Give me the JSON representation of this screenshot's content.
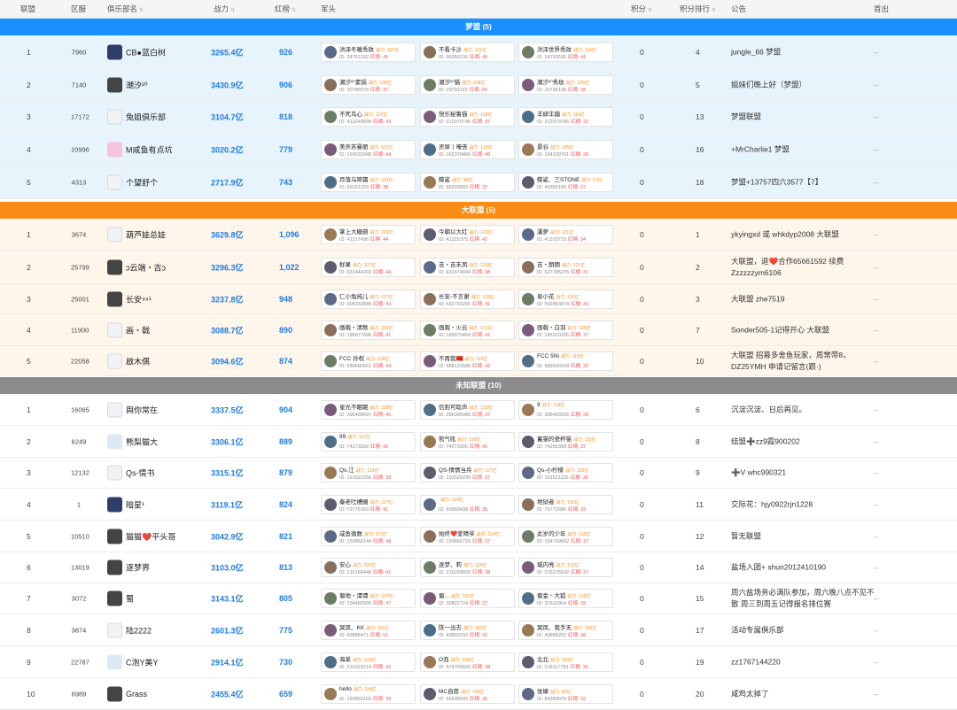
{
  "columns": {
    "rank": "联盟",
    "zone": "区服",
    "club": "俱乐部名",
    "power": "战力",
    "red": "红榜",
    "leader": "军头",
    "score": "积分",
    "score_rank": "积分排行",
    "notice": "公告",
    "first": "首出"
  },
  "sections": [
    {
      "title": "梦盟 (5)",
      "theme": "blue",
      "color": "#1890ff",
      "rows": [
        {
          "rank": "1",
          "zone": "7960",
          "club": "CB●蓝白树",
          "power": "3265.4亿",
          "red": "926",
          "leaders": [
            {
              "name": "洪泽冬暖秀玫",
              "power": "战力: 123亿",
              "id": "ID: 24761232",
              "red": "红榜: 45"
            },
            {
              "name": "不看卡沙",
              "power": "战力: 121亿",
              "id": "ID: 95359136",
              "red": "红榜: 45"
            },
            {
              "name": "洪泽世界秀玫",
              "power": "战力: 119亿",
              "id": "ID: 24763535",
              "red": "红榜: 41"
            }
          ],
          "score": "0",
          "score_rank": "4",
          "notice": "jungle_66 梦盟",
          "first": "--"
        },
        {
          "rank": "2",
          "zone": "7140",
          "club": "潮汐²⁰",
          "power": "3430.9亿",
          "red": "906",
          "leaders": [
            {
              "name": "潮汐²⁰素锅",
              "power": "战力: 130亿",
              "id": "ID: 20786079",
              "red": "红榜: 37"
            },
            {
              "name": "潮汐²⁰猫",
              "power": "战力: 128亿",
              "id": "ID: 20791122",
              "red": "红榜: 34"
            },
            {
              "name": "潮汐²⁰秀玫",
              "power": "战力: 126亿",
              "id": "ID: 20795108",
              "red": "红榜: 28"
            }
          ],
          "score": "0",
          "score_rank": "5",
          "notice": "姐妹们晚上好（梦盟）",
          "first": "--"
        },
        {
          "rank": "3",
          "zone": "17172",
          "club": "兔姐俱乐部",
          "power": "3104.7亿",
          "red": "818",
          "leaders": [
            {
              "name": "不死鸟心",
              "power": "战力: 122亿",
              "id": "ID: 413249599",
              "red": "红榜: 43"
            },
            {
              "name": "快乐秘鲁猫",
              "power": "战力: 118亿",
              "id": "ID: 312079746",
              "red": "红榜: 37"
            },
            {
              "name": "丰肆丰蹦",
              "power": "战力: 113亿",
              "id": "ID: 312079786",
              "red": "红榜: 32"
            }
          ],
          "score": "0",
          "score_rank": "13",
          "notice": "梦盟联盟",
          "first": "--"
        },
        {
          "rank": "4",
          "zone": "10996",
          "club": "M咸鱼有点坑",
          "power": "3020.2亿",
          "red": "779",
          "leaders": [
            {
              "name": "美声苏曼丽",
              "power": "战力: 121亿",
              "id": "ID: 155633348",
              "red": "红榜: 44"
            },
            {
              "name": "灵犀丨嚎丧",
              "power": "战力: 119亿",
              "id": "ID: 162378466",
              "red": "红榜: 43"
            },
            {
              "name": "景谷",
              "power": "战力: 105亿",
              "id": "ID: 154109761",
              "red": "红榜: 26"
            }
          ],
          "score": "0",
          "score_rank": "16",
          "notice": "+MrCharlie1 梦盟",
          "first": "--"
        },
        {
          "rank": "5",
          "zone": "4313",
          "club": "个望舒个",
          "power": "2717.9亿",
          "red": "743",
          "leaders": [
            {
              "name": "月落乌啼霜",
              "power": "战力: 101亿",
              "id": "ID: 50161229",
              "red": "红榜: 38"
            },
            {
              "name": "鲸鲨",
              "power": "战力: 98亿",
              "id": "ID: 66203802",
              "red": "红榜: 32"
            },
            {
              "name": "鲸鲨、三STONE",
              "power": "战力: 97亿",
              "id": "ID: 49355189",
              "red": "红榜: 27"
            }
          ],
          "score": "0",
          "score_rank": "18",
          "notice": "梦盟+13757四六3577【7】",
          "first": "--"
        }
      ]
    },
    {
      "title": "大联盟 (5)",
      "theme": "orange",
      "color": "#fa8c16",
      "rows": [
        {
          "rank": "1",
          "zone": "3674",
          "club": "葫芦娃总娃",
          "power": "3629.8亿",
          "red": "1,096",
          "leaders": [
            {
              "name": "掌上大糖葫",
              "power": "战力: 129亿",
              "id": "ID: 41317436",
              "red": "红榜: 44"
            },
            {
              "name": "今朝以大红",
              "power": "战力: 123亿",
              "id": "ID: 41315375",
              "red": "红榜: 42"
            },
            {
              "name": "瀑萝",
              "power": "战力: 121亿",
              "id": "ID: 41315710",
              "red": "红榜: 34"
            }
          ],
          "score": "0",
          "score_rank": "1",
          "notice": "ykyingxd 或 whkdyp2008 大联盟",
          "first": "--"
        },
        {
          "rank": "2",
          "zone": "25799",
          "club": "ↄ云端・吉ↄ",
          "power": "3296.3亿",
          "red": "1,022",
          "leaders": [
            {
              "name": "鲜果",
              "power": "战力: 127亿",
              "id": "ID: 631444202",
              "red": "红榜: 44"
            },
            {
              "name": "吉・吉末凤",
              "power": "战力: 125亿",
              "id": "ID: 631474844",
              "red": "红榜: 38"
            },
            {
              "name": "吉・朗朗",
              "power": "战力: 121亿",
              "id": "ID: 627785376",
              "red": "红榜: 31"
            }
          ],
          "score": "0",
          "score_rank": "2",
          "notice": "大联盟，退❤️合作65661592 续费Zzzzzzym6106",
          "first": "--"
        },
        {
          "rank": "3",
          "zone": "25001",
          "club": "长安⁹⁹¹",
          "power": "3237.8亿",
          "red": "948",
          "leaders": [
            {
              "name": "仁小兔纯儿",
              "power": "战力: 127亿",
              "id": "ID: 608333589",
              "red": "红榜: 43"
            },
            {
              "name": "长安-不言谢",
              "power": "战力: 123亿",
              "id": "ID: 592733265",
              "red": "红榜: 41"
            },
            {
              "name": "易小花",
              "power": "战力: 115亿",
              "id": "ID: 592863874",
              "red": "红榜: 36"
            }
          ],
          "score": "0",
          "score_rank": "3",
          "notice": "大联盟 zhe7519",
          "first": "--"
        },
        {
          "rank": "4",
          "zone": "11900",
          "club": "画・戟",
          "power": "3088.7亿",
          "red": "890",
          "leaders": [
            {
              "name": "画戟・清歌",
              "power": "战力: 122亿",
              "id": "ID: 185877496",
              "red": "红榜: 41"
            },
            {
              "name": "画戟・火云",
              "power": "战力: 121亿",
              "id": "ID: 185870464",
              "red": "红榜: 41"
            },
            {
              "name": "画戟・白羽",
              "power": "战力: 120亿",
              "id": "ID: 185310326",
              "red": "红榜: 37"
            }
          ],
          "score": "0",
          "score_rank": "7",
          "notice": "Sonder505-1记得开心 大联盟",
          "first": "--"
        },
        {
          "rank": "5",
          "zone": "22058",
          "club": "啟︎木偶",
          "power": "3094.6亿",
          "red": "874",
          "leaders": [
            {
              "name": "FCC 孙权",
              "power": "战力: 128亿",
              "id": "ID: 589690561",
              "red": "红榜: 44"
            },
            {
              "name": "不再我🇨🇳",
              "power": "战力: 115亿",
              "id": "ID: 588133589",
              "red": "红榜: 42"
            },
            {
              "name": "FCC 5Ni",
              "power": "战力: 119亿",
              "id": "ID: 589600109",
              "red": "红榜: 32"
            }
          ],
          "score": "0",
          "score_rank": "10",
          "notice": "大联盟 招募多舍鱼玩家，周常带8，DZ25YMH 申请记留言(跟·)",
          "first": "--"
        }
      ]
    },
    {
      "title": "未知联盟 (10)",
      "theme": "white",
      "color": "#8c8c8c",
      "rows": [
        {
          "rank": "1",
          "zone": "16065",
          "club": "舆你常在",
          "power": "3337.5亿",
          "red": "904",
          "leaders": [
            {
              "name": "星光不眠眠",
              "power": "战力: 128亿",
              "id": "ID: 396499697",
              "red": "红榜: 46"
            },
            {
              "name": "信则可取声",
              "power": "战力: 120亿",
              "id": "ID: 396395086",
              "red": "红榜: 37"
            },
            {
              "name": "9",
              "power": "战力: 119亿",
              "id": "ID: 398499335",
              "red": "红榜: 28"
            }
          ],
          "score": "0",
          "score_rank": "6",
          "notice": "沉淀沉淀、日后再见。",
          "first": "--"
        },
        {
          "rank": "2",
          "zone": "6249",
          "club": "熊梨猫大",
          "power": "3306.1亿",
          "red": "889",
          "leaders": [
            {
              "name": "99",
              "power": "战力: 127亿",
              "id": "ID: 74273299",
              "red": "红榜: 43"
            },
            {
              "name": "熊气吼",
              "power": "战力: 126亿",
              "id": "ID: 74273306",
              "red": "红榜: 41"
            },
            {
              "name": "蓄猫的瓷杯猫",
              "power": "战力: 115亿",
              "id": "ID: 74265399",
              "red": "红榜: 37"
            }
          ],
          "score": "0",
          "score_rank": "8",
          "notice": "结盟➕zz9霞900202",
          "first": "--"
        },
        {
          "rank": "3",
          "zone": "12132",
          "club": "Qs-情书",
          "power": "3315.1亿",
          "red": "879",
          "leaders": [
            {
              "name": "Qs.江",
              "power": "战力: 131亿",
              "id": "ID: 191522256",
              "red": "红榜: 38"
            },
            {
              "name": "QS-情情当兵",
              "power": "战力: 127亿",
              "id": "ID: 191520200",
              "red": "红榜: 37"
            },
            {
              "name": "Qs-小柠檬",
              "power": "战力: 126亿",
              "id": "ID: 191521125",
              "red": "红榜: 35"
            }
          ],
          "score": "0",
          "score_rank": "9",
          "notice": "➕V whc990321",
          "first": "--"
        },
        {
          "rank": "4",
          "zone": "1",
          "club": "暗星¹",
          "power": "3119.1亿",
          "red": "824",
          "leaders": [
            {
              "name": "秦老吐槽圈",
              "power": "战力: 127亿",
              "id": "ID: 73776393",
              "red": "红榜: 41"
            },
            {
              "name": "",
              "power": "战力: 119亿",
              "id": "ID: 60983438",
              "red": "红榜: 35"
            },
            {
              "name": "地狱者",
              "power": "战力: 115亿",
              "id": "ID: 76772686",
              "red": "红榜: 32"
            }
          ],
          "score": "0",
          "score_rank": "11",
          "notice": "交际花：hjy0922rjn1228",
          "first": "--"
        },
        {
          "rank": "5",
          "zone": "10510",
          "club": "猫猫❤️平头哥",
          "power": "3042.9亿",
          "red": "821",
          "leaders": [
            {
              "name": "咸鱼微数",
              "power": "战力: 117亿",
              "id": "ID: 150866144",
              "red": "红榜: 48"
            },
            {
              "name": "始终❤️爱晴爷",
              "power": "战力: 114亿",
              "id": "ID: 150866715",
              "red": "红榜: 37"
            },
            {
              "name": "此岁的少年",
              "power": "战力: 110亿",
              "id": "ID: 154709662",
              "red": "红榜: 37"
            }
          ],
          "score": "0",
          "score_rank": "12",
          "notice": "暂无联盟",
          "first": "--"
        },
        {
          "rank": "6",
          "zone": "13019",
          "club": "逐梦界",
          "power": "3103.0亿",
          "red": "813",
          "leaders": [
            {
              "name": "安心",
              "power": "战力: 126亿",
              "id": "ID: 215180448",
              "red": "红榜: 41"
            },
            {
              "name": "逐梦、莉",
              "power": "战力: 124亿",
              "id": "ID: 215269826",
              "red": "红榜: 38"
            },
            {
              "name": "城内亮",
              "power": "战力: 113亿",
              "id": "ID: 215275542",
              "red": "红榜: 37"
            }
          ],
          "score": "0",
          "score_rank": "14",
          "notice": "盐场入团+ shun2012410190",
          "first": "--"
        },
        {
          "rank": "7",
          "zone": "3072",
          "club": "蜀",
          "power": "3143.1亿",
          "red": "805",
          "leaders": [
            {
              "name": "蜀地・谭谭",
              "power": "战力: 127亿",
              "id": "ID: 234460309",
              "red": "红榜: 47"
            },
            {
              "name": "蜀...",
              "power": "战力: 121亿",
              "id": "ID: 30822724",
              "red": "红榜: 37"
            },
            {
              "name": "蜀金丶大狐",
              "power": "战力: 116亿",
              "id": "ID: 37610364",
              "red": "红榜: 33"
            }
          ],
          "score": "0",
          "score_rank": "15",
          "notice": "周六盐场务必满队参加，周六晚八点不见不散 周三到周五记得报名排位赛",
          "first": "--"
        },
        {
          "rank": "8",
          "zone": "3874",
          "club": "陆2222",
          "power": "2601.3亿",
          "red": "775",
          "leaders": [
            {
              "name": "冥凤、KK",
              "power": "战力: 111亿",
              "id": "ID: 43886471",
              "red": "红榜: 51"
            },
            {
              "name": "陈一出去",
              "power": "战力: 109亿",
              "id": "ID: 43893232",
              "red": "红榜: 42"
            },
            {
              "name": "冥凤、我手无",
              "power": "战力: 105亿",
              "id": "ID: 43885252",
              "red": "红榜: 38"
            }
          ],
          "score": "0",
          "score_rank": "17",
          "notice": "活动专属俱乐部",
          "first": "--"
        },
        {
          "rank": "9",
          "zone": "22787",
          "club": "C泡Y美Y",
          "power": "2914.1亿",
          "red": "730",
          "leaders": [
            {
              "name": "海某",
              "power": "战力: 128亿",
              "id": "ID: 515323214",
              "red": "红榜: 42"
            },
            {
              "name": "O泡",
              "power": "战力: 109亿",
              "id": "ID: 574765600",
              "red": "红榜: 38"
            },
            {
              "name": "北北",
              "power": "战力: 103亿",
              "id": "ID: 518117781",
              "red": "红榜: 36"
            }
          ],
          "score": "0",
          "score_rank": "19",
          "notice": "zz1767144220",
          "first": "--"
        },
        {
          "rank": "10",
          "zone": "6989",
          "club": "Grass",
          "power": "2455.4亿",
          "red": "659",
          "leaders": [
            {
              "name": "hello",
              "power": "战力: 114亿",
              "id": "ID: 160892103",
              "red": "红榜: 39"
            },
            {
              "name": "MC自愿",
              "power": "战力: 109亿",
              "id": "ID: 95635935",
              "red": "红榜: 35"
            },
            {
              "name": "张婕",
              "power": "战力: 96亿",
              "id": "ID: 84389976",
              "red": "红榜: 32"
            }
          ],
          "score": "0",
          "score_rank": "20",
          "notice": "咸鸡太掉了",
          "first": "--"
        }
      ]
    }
  ]
}
